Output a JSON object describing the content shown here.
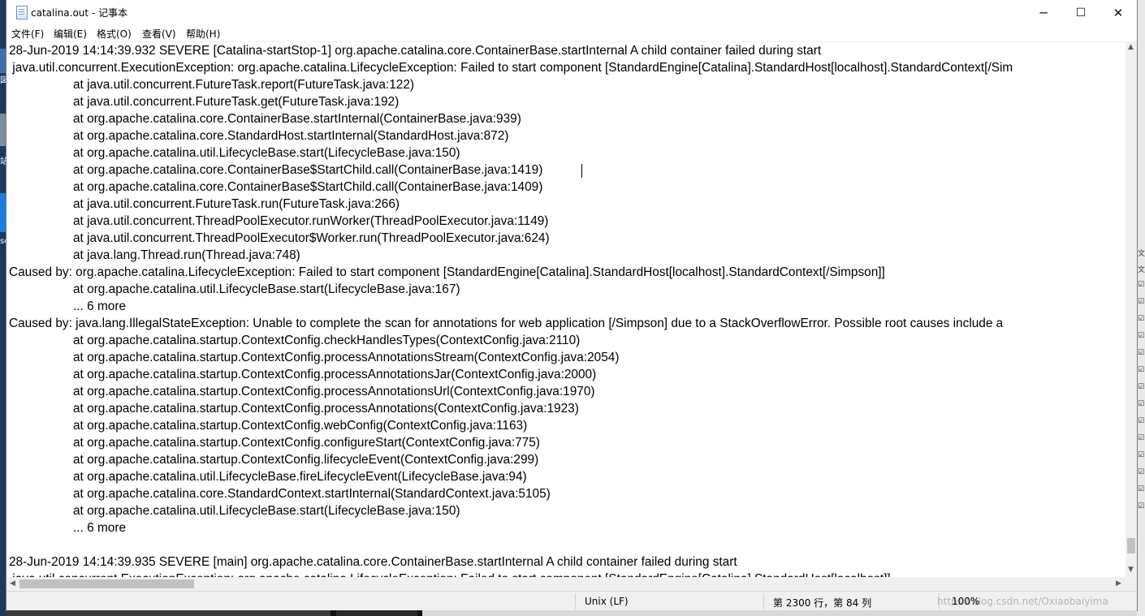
{
  "window": {
    "title": "catalina.out - 记事本",
    "controls": {
      "minimize": "─",
      "maximize": "☐",
      "close": "✕"
    }
  },
  "menu": [
    "文件(F)",
    "编辑(E)",
    "格式(O)",
    "查看(V)",
    "帮助(H)"
  ],
  "lines": [
    "28-Jun-2019 14:14:39.932 SEVERE [Catalina-startStop-1] org.apache.catalina.core.ContainerBase.startInternal A child container failed during start",
    " java.util.concurrent.ExecutionException: org.apache.catalina.LifecycleException: Failed to start component [StandardEngine[Catalina].StandardHost[localhost].StandardContext[/Sim",
    "\tat java.util.concurrent.FutureTask.report(FutureTask.java:122)",
    "\tat java.util.concurrent.FutureTask.get(FutureTask.java:192)",
    "\tat org.apache.catalina.core.ContainerBase.startInternal(ContainerBase.java:939)",
    "\tat org.apache.catalina.core.StandardHost.startInternal(StandardHost.java:872)",
    "\tat org.apache.catalina.util.LifecycleBase.start(LifecycleBase.java:150)",
    "\tat org.apache.catalina.core.ContainerBase$StartChild.call(ContainerBase.java:1419)",
    "\tat org.apache.catalina.core.ContainerBase$StartChild.call(ContainerBase.java:1409)",
    "\tat java.util.concurrent.FutureTask.run(FutureTask.java:266)",
    "\tat java.util.concurrent.ThreadPoolExecutor.runWorker(ThreadPoolExecutor.java:1149)",
    "\tat java.util.concurrent.ThreadPoolExecutor$Worker.run(ThreadPoolExecutor.java:624)",
    "\tat java.lang.Thread.run(Thread.java:748)",
    "Caused by: org.apache.catalina.LifecycleException: Failed to start component [StandardEngine[Catalina].StandardHost[localhost].StandardContext[/Simpson]]",
    "\tat org.apache.catalina.util.LifecycleBase.start(LifecycleBase.java:167)",
    "\t... 6 more",
    "Caused by: java.lang.IllegalStateException: Unable to complete the scan for annotations for web application [/Simpson] due to a StackOverflowError. Possible root causes include a",
    "\tat org.apache.catalina.startup.ContextConfig.checkHandlesTypes(ContextConfig.java:2110)",
    "\tat org.apache.catalina.startup.ContextConfig.processAnnotationsStream(ContextConfig.java:2054)",
    "\tat org.apache.catalina.startup.ContextConfig.processAnnotationsJar(ContextConfig.java:2000)",
    "\tat org.apache.catalina.startup.ContextConfig.processAnnotationsUrl(ContextConfig.java:1970)",
    "\tat org.apache.catalina.startup.ContextConfig.processAnnotations(ContextConfig.java:1923)",
    "\tat org.apache.catalina.startup.ContextConfig.webConfig(ContextConfig.java:1163)",
    "\tat org.apache.catalina.startup.ContextConfig.configureStart(ContextConfig.java:775)",
    "\tat org.apache.catalina.startup.ContextConfig.lifecycleEvent(ContextConfig.java:299)",
    "\tat org.apache.catalina.util.LifecycleBase.fireLifecycleEvent(LifecycleBase.java:94)",
    "\tat org.apache.catalina.core.StandardContext.startInternal(StandardContext.java:5105)",
    "\tat org.apache.catalina.util.LifecycleBase.start(LifecycleBase.java:150)",
    "\t... 6 more",
    "",
    "28-Jun-2019 14:14:39.935 SEVERE [main] org.apache.catalina.core.ContainerBase.startInternal A child container failed during start",
    " java.util.concurrent.ExecutionException: org.apache.catalina.LifecycleException: Failed to start component [StandardEngine[Catalina].StandardHost[localhost]]"
  ],
  "status": {
    "encoding": "Unix (LF)",
    "position": "第 2300 行，第 84 列",
    "zoom": "100%",
    "watermark": "https://blog.csdn.net/Oxiaobaiyima"
  },
  "desktop_fragments": {
    "left": [
      "図",
      "站",
      "sc"
    ],
    "right_glyphs": [
      "文",
      "文",
      "☑",
      "☑",
      "☑",
      "☑",
      "☑",
      "☑",
      "☑",
      "☑",
      "☑",
      "☑",
      "☑",
      "☑",
      "☑",
      "☑"
    ]
  },
  "colors": {
    "editor_bg": "#ffffff",
    "chrome_bg": "#f0f0f0",
    "desktop_blue": "#1d3a5c"
  }
}
